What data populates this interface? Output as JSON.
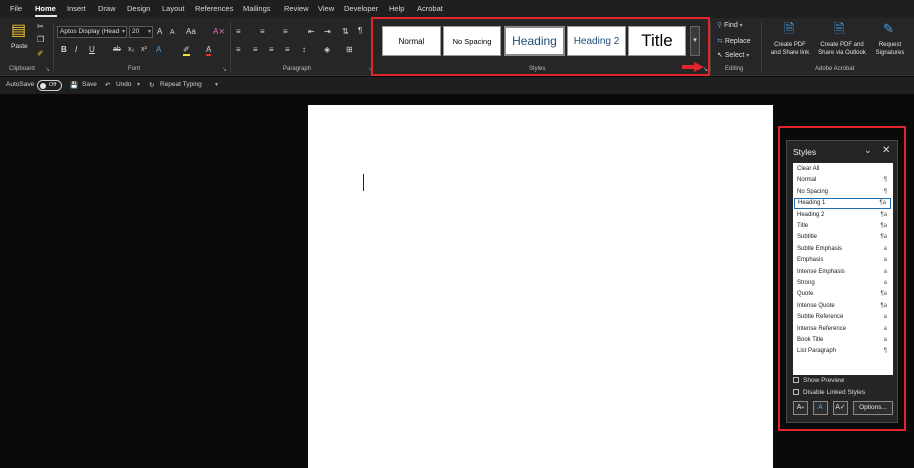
{
  "colors": {
    "accent_red": "#e0252b",
    "selection_blue": "#1f6fb2",
    "acrobat_blue": "#4a9fe3"
  },
  "menu": [
    "File",
    "Home",
    "Insert",
    "Draw",
    "Design",
    "Layout",
    "References",
    "Mailings",
    "Review",
    "View",
    "Developer",
    "Help",
    "Acrobat"
  ],
  "ribbon": {
    "clipboard": {
      "paste_label": "Paste",
      "group_label": "Clipboard"
    },
    "font": {
      "font_name": "Aptos Display (Head",
      "font_size": "20",
      "group_label": "Font",
      "bold": "B",
      "italic": "I",
      "underline": "U",
      "strike": "ab",
      "sub": "x₂",
      "sup": "x²",
      "grow": "A",
      "shrink": "A",
      "case": "Aa",
      "color_a": "A"
    },
    "paragraph": {
      "group_label": "Paragraph",
      "pilcrow": "¶"
    },
    "styles": {
      "group_label": "Styles",
      "tiles": [
        "Normal",
        "No Spacing",
        "Heading",
        "Heading 2",
        "Title"
      ],
      "more": "▾"
    },
    "editing": {
      "find": "Find",
      "replace": "Replace",
      "select": "Select",
      "group_label": "Editing"
    },
    "acrobat": {
      "create_pdf_1": "Create PDF",
      "create_pdf_2": "and Share link",
      "share_outlook_1": "Create PDF and",
      "share_outlook_2": "Share via Outlook",
      "request_sig_1": "Request",
      "request_sig_2": "Signatures",
      "group_label": "Adobe Acrobat"
    }
  },
  "qat": {
    "autosave": "AutoSave",
    "autosave_state": "Off",
    "save": "Save",
    "undo": "Undo",
    "repeat": "Repeat Typing"
  },
  "styles_pane": {
    "title": "Styles",
    "items": [
      {
        "name": "Clear All",
        "mark": ""
      },
      {
        "name": "Normal",
        "mark": "¶"
      },
      {
        "name": "No Spacing",
        "mark": "¶"
      },
      {
        "name": "Heading 1",
        "mark": "¶a"
      },
      {
        "name": "Heading 2",
        "mark": "¶a"
      },
      {
        "name": "Title",
        "mark": "¶a"
      },
      {
        "name": "Subtitle",
        "mark": "¶a"
      },
      {
        "name": "Subtle Emphasis",
        "mark": "a"
      },
      {
        "name": "Emphasis",
        "mark": "a"
      },
      {
        "name": "Intense Emphasis",
        "mark": "a"
      },
      {
        "name": "Strong",
        "mark": "a"
      },
      {
        "name": "Quote",
        "mark": "¶a"
      },
      {
        "name": "Intense Quote",
        "mark": "¶a"
      },
      {
        "name": "Subtle Reference",
        "mark": "a"
      },
      {
        "name": "Intense Reference",
        "mark": "a"
      },
      {
        "name": "Book Title",
        "mark": "a"
      },
      {
        "name": "List Paragraph",
        "mark": "¶"
      }
    ],
    "selected": "Heading 1",
    "show_preview": "Show Preview",
    "disable_linked": "Disable Linked Styles",
    "options": "Options..."
  }
}
